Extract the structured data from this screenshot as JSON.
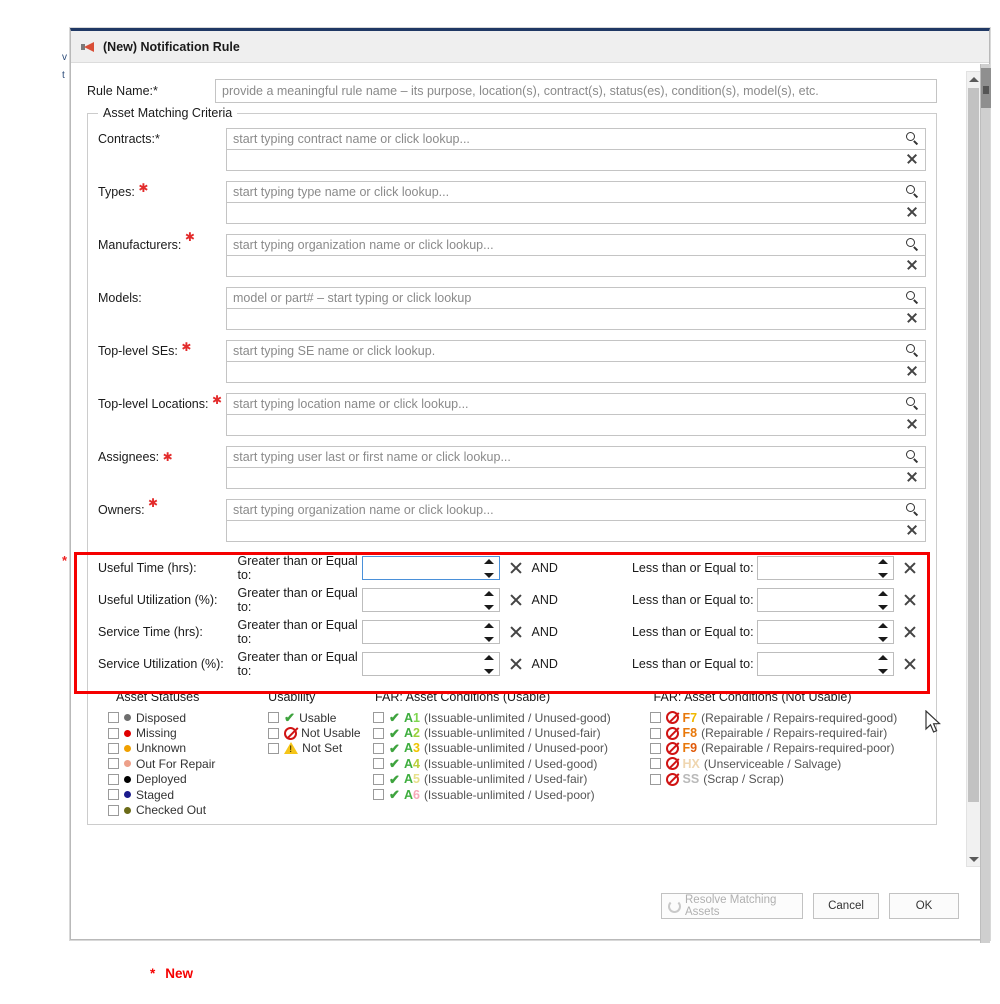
{
  "background": {
    "left_fragments": [
      "v",
      "t"
    ]
  },
  "dialog": {
    "title": "(New) Notification Rule",
    "title_icon": "megaphone-icon"
  },
  "rule_name": {
    "label": "Rule Name:*",
    "placeholder": "provide a meaningful rule name – its purpose, location(s), contract(s), status(es), condition(s), model(s), etc."
  },
  "asset_matching": {
    "legend": "Asset Matching Criteria",
    "fields": [
      {
        "label": "Contracts:*",
        "required_inline": false,
        "placeholder": "start typing contract name or click lookup..."
      },
      {
        "label": "Types:",
        "required_inline": true,
        "placeholder": "start typing type name or click lookup..."
      },
      {
        "label": "Manufacturers:",
        "required_inline": true,
        "placeholder": "start typing organization name or click lookup..."
      },
      {
        "label": "Models:",
        "required_inline": false,
        "placeholder": "model or part# – start typing or click lookup"
      },
      {
        "label": "Top-level SEs:",
        "required_inline": true,
        "placeholder": "start typing SE name or click lookup."
      },
      {
        "label": "Top-level Locations:",
        "required_inline": true,
        "placeholder": "start typing location name or click lookup..."
      },
      {
        "label": "Assignees:",
        "required_inline": true,
        "placeholder": "start typing user last or first name or click lookup..."
      },
      {
        "label": "Owners:",
        "required_inline": true,
        "placeholder": "start typing organization name or click lookup..."
      }
    ]
  },
  "numeric_criteria": {
    "gte_label": "Greater than or Equal to:",
    "lte_label": "Less than or Equal to:",
    "and_label": "AND",
    "rows": [
      {
        "label": "Useful Time (hrs):",
        "gte_value": "",
        "lte_value": "",
        "focused": true
      },
      {
        "label": "Useful Utilization (%):",
        "gte_value": "",
        "lte_value": "",
        "focused": false
      },
      {
        "label": "Service Time (hrs):",
        "gte_value": "",
        "lte_value": "",
        "focused": false
      },
      {
        "label": "Service Utilization (%):",
        "gte_value": "",
        "lte_value": "",
        "focused": false
      }
    ]
  },
  "columns": {
    "asset_statuses": {
      "title": "Asset Statuses",
      "items": [
        {
          "label": "Disposed",
          "color": "#6e6e6e"
        },
        {
          "label": "Missing",
          "color": "#e00000"
        },
        {
          "label": "Unknown",
          "color": "#f0a000"
        },
        {
          "label": "Out For Repair",
          "color": "#eda089"
        },
        {
          "label": "Deployed",
          "color": "#000000"
        },
        {
          "label": "Staged",
          "color": "#1a1a8c"
        },
        {
          "label": "Checked Out",
          "color": "#6b6b18"
        }
      ]
    },
    "usability": {
      "title": "Usability",
      "items": [
        {
          "label": "Usable",
          "icon": "green-check-icon"
        },
        {
          "label": "Not Usable",
          "icon": "no-entry-icon"
        },
        {
          "label": "Not Set",
          "icon": "warning-triangle-icon"
        }
      ]
    },
    "far_usable": {
      "title": "FAR: Asset Conditions (Usable)",
      "items": [
        {
          "code_letter": "A",
          "code_digit": "1",
          "digit_color": "#7fd64f",
          "desc": "(Issuable-unlimited / Unused-good)"
        },
        {
          "code_letter": "A",
          "code_digit": "2",
          "digit_color": "#9bd13c",
          "desc": "(Issuable-unlimited / Unused-fair)"
        },
        {
          "code_letter": "A",
          "code_digit": "3",
          "digit_color": "#f0c400",
          "desc": "(Issuable-unlimited / Unused-poor)"
        },
        {
          "code_letter": "A",
          "code_digit": "4",
          "digit_color": "#b9cf3a",
          "desc": "(Issuable-unlimited / Used-good)"
        },
        {
          "code_letter": "A",
          "code_digit": "5",
          "digit_color": "#e8e08a",
          "desc": "(Issuable-unlimited / Used-fair)"
        },
        {
          "code_letter": "A",
          "code_digit": "6",
          "digit_color": "#f7a8b8",
          "desc": "(Issuable-unlimited / Used-poor)"
        }
      ],
      "letter_color": "#3fae3f"
    },
    "far_not_usable": {
      "title": "FAR: Asset Conditions (Not Usable)",
      "items": [
        {
          "code": "F7",
          "code_color": "#e8780a",
          "digit_color": "#f0b800",
          "desc": "(Repairable / Repairs-required-good)"
        },
        {
          "code": "F8",
          "code_color": "#e8780a",
          "digit_color": "#e8780a",
          "desc": "(Repairable / Repairs-required-fair)"
        },
        {
          "code": "F9",
          "code_color": "#e8780a",
          "digit_color": "#e05a0a",
          "desc": "(Repairable / Repairs-required-poor)"
        },
        {
          "code": "HX",
          "code_color": "#efd6b0",
          "digit_color": "#efd6b0",
          "desc": "(Unserviceable / Salvage)"
        },
        {
          "code": "SS",
          "code_color": "#b9b9b9",
          "digit_color": "#b9b9b9",
          "desc": "(Scrap / Scrap)"
        }
      ]
    }
  },
  "footer": {
    "resolve_label": "Resolve Matching Assets",
    "cancel_label": "Cancel",
    "ok_label": "OK"
  },
  "annotation": {
    "star": "*",
    "text": "New"
  },
  "colors": {
    "required_star": "#e32b2b",
    "highlight_border": "#f50000",
    "titlebar_accent": "#1f3864"
  }
}
